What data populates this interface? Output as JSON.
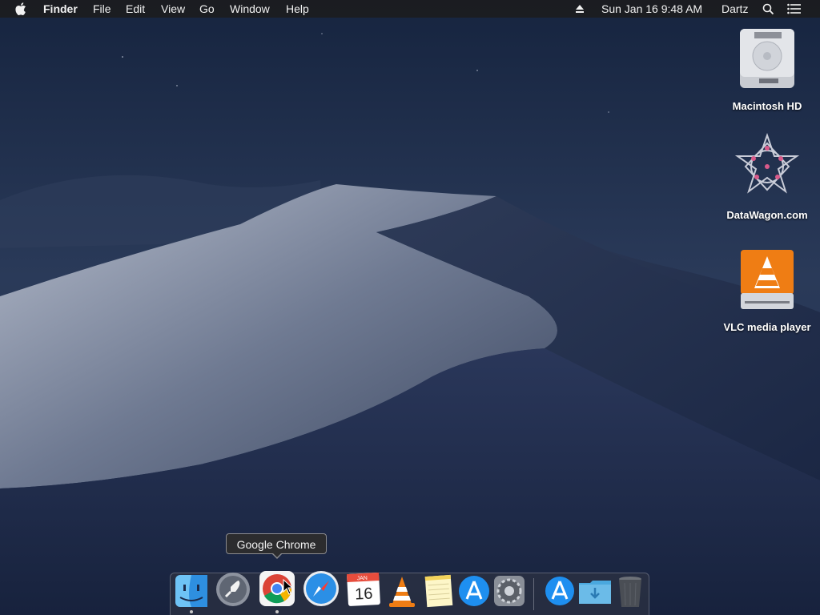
{
  "menubar": {
    "app_name": "Finder",
    "menus": [
      "File",
      "Edit",
      "View",
      "Go",
      "Window",
      "Help"
    ],
    "datetime": "Sun Jan 16  9:48 AM",
    "user": "Dartz",
    "icons": [
      "apple-icon",
      "eject-icon",
      "spotlight-search-icon",
      "notification-center-icon"
    ]
  },
  "desktop": {
    "icons": [
      {
        "label": "Macintosh HD",
        "icon": "hard-drive-icon"
      },
      {
        "label": "DataWagon.com",
        "icon": "datawagon-star-icon"
      },
      {
        "label": "VLC media player",
        "icon": "vlc-cone-icon"
      }
    ]
  },
  "dock": {
    "tooltip": "Google Chrome",
    "items": [
      {
        "name": "Finder",
        "icon": "finder-icon",
        "running": true
      },
      {
        "name": "Launchpad",
        "icon": "launchpad-icon",
        "running": false
      },
      {
        "name": "Google Chrome",
        "icon": "chrome-icon",
        "running": true
      },
      {
        "name": "Safari",
        "icon": "safari-icon",
        "running": false
      },
      {
        "name": "Calendar",
        "icon": "calendar-icon",
        "running": false,
        "month": "JAN",
        "day": "16"
      },
      {
        "name": "VLC",
        "icon": "vlc-icon",
        "running": false
      },
      {
        "name": "Notes",
        "icon": "notes-icon",
        "running": false
      },
      {
        "name": "App Store",
        "icon": "app-store-icon",
        "running": false
      },
      {
        "name": "System Preferences",
        "icon": "system-preferences-icon",
        "running": false
      },
      {
        "name": "Applications",
        "icon": "applications-folder-icon",
        "running": false
      },
      {
        "name": "Downloads",
        "icon": "downloads-folder-icon",
        "running": false
      },
      {
        "name": "Trash",
        "icon": "trash-icon",
        "running": false
      }
    ]
  },
  "colors": {
    "sky_top": "#1a2a4a",
    "sky_bottom": "#2c3c5c",
    "dune_light": "#9aa3b6",
    "dune_dark": "#1f2c4a",
    "menubar_bg": "#1c1c1e"
  }
}
